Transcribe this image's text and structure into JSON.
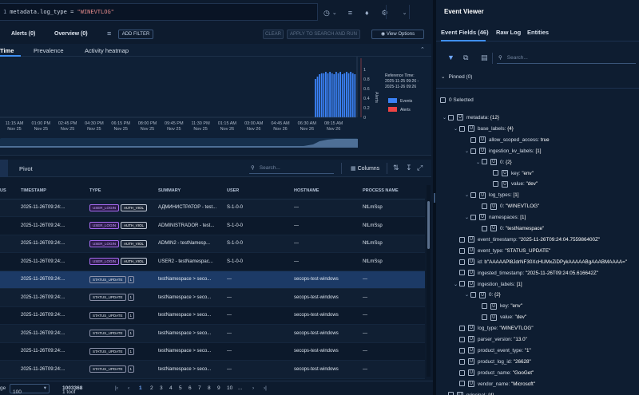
{
  "query": {
    "line": "1",
    "text_prefix": "metadata.log_type = ",
    "text_value": "\"WINEVTLOG\""
  },
  "toolbar": {
    "alerts_tab": "Alerts (0)",
    "overview_tab": "Overview (0)",
    "add_filter": "ADD FILTER",
    "clear": "CLEAR",
    "apply": "APPLY TO SEARCH AND RUN",
    "view_options": "View Options"
  },
  "chart_tabs": [
    {
      "label": "Time"
    },
    {
      "label": "Prevalence"
    },
    {
      "label": "Activity heatmap"
    }
  ],
  "chart_data": {
    "type": "bar",
    "x_tick_labels": [
      {
        "time": "11:15 AM",
        "date": "Nov 25"
      },
      {
        "time": "01:00 PM",
        "date": "Nov 25"
      },
      {
        "time": "02:45 PM",
        "date": "Nov 25"
      },
      {
        "time": "04:30 PM",
        "date": "Nov 25"
      },
      {
        "time": "06:15 PM",
        "date": "Nov 25"
      },
      {
        "time": "08:00 PM",
        "date": "Nov 25"
      },
      {
        "time": "09:45 PM",
        "date": "Nov 25"
      },
      {
        "time": "11:30 PM",
        "date": "Nov 25"
      },
      {
        "time": "01:15 AM",
        "date": "Nov 26"
      },
      {
        "time": "03:00 AM",
        "date": "Nov 26"
      },
      {
        "time": "04:45 AM",
        "date": "Nov 26"
      },
      {
        "time": "06:30 AM",
        "date": "Nov 26"
      },
      {
        "time": "08:15 AM",
        "date": "Nov 26"
      }
    ],
    "y_ticks": [
      "1",
      "0.8",
      "0.6",
      "0.4",
      "0.2",
      "0"
    ],
    "y_label": "Alerts",
    "ylim": [
      0,
      1
    ],
    "bar_values": [
      0.8,
      0.85,
      0.9,
      0.92,
      0.92,
      0.95,
      0.92,
      0.95,
      0.92,
      0.9,
      0.95,
      0.92,
      0.95,
      0.9,
      0.92,
      0.95,
      0.92,
      0.95,
      0.92,
      0.9
    ],
    "reference_title": "Reference Time:",
    "reference_from": "2025-11-25 09:26 -",
    "reference_to": "2025-11-26 09:26",
    "legend": [
      {
        "name": "Events",
        "color": "#3b82f6"
      },
      {
        "name": "Alerts",
        "color": "#ef4444"
      }
    ]
  },
  "events_bar": {
    "pivot": "Pivot",
    "search_placeholder": "Search...",
    "columns": "Columns"
  },
  "table": {
    "headers": [
      "US",
      "TIMESTAMP",
      "TYPE",
      "SUMMARY",
      "USER",
      "HOSTNAME",
      "PROCESS NAME"
    ],
    "rows": [
      {
        "ts": "2025-11-26T09:24:...",
        "t1": "USER_LOGIN",
        "t2": "AUTH_VIOL",
        "summary": "АДМИНИСТРАТОР - test...",
        "user": "S-1-0-0",
        "host": "—",
        "proc": "NtLmSsp"
      },
      {
        "ts": "2025-11-26T09:24:...",
        "t1": "USER_LOGIN",
        "t2": "AUTH_VIOL",
        "summary": "ADMINISTRADOR - test...",
        "user": "S-1-0-0",
        "host": "—",
        "proc": "NtLmSsp"
      },
      {
        "ts": "2025-11-26T09:24:...",
        "t1": "USER_LOGIN",
        "t2": "AUTH_VIOL",
        "summary": "ADMIN2 - testNamesp...",
        "user": "S-1-0-0",
        "host": "—",
        "proc": "NtLmSsp"
      },
      {
        "ts": "2025-11-26T09:24:...",
        "t1": "USER_LOGIN",
        "t2": "AUTH_VIOL",
        "summary": "USER2 - testNamespac...",
        "user": "S-1-0-0",
        "host": "—",
        "proc": "NtLmSsp"
      },
      {
        "ts": "2025-11-26T09:24:...",
        "t1": "STATUS_UPDATE",
        "t2": "1",
        "summary": "testNamespace > seco...",
        "user": "—",
        "host": "secops-test-windows",
        "proc": "—"
      },
      {
        "ts": "2025-11-26T09:24:...",
        "t1": "STATUS_UPDATE",
        "t2": "1",
        "summary": "testNamespace > seco...",
        "user": "—",
        "host": "secops-test-windows",
        "proc": "—"
      },
      {
        "ts": "2025-11-26T09:24:...",
        "t1": "STATUS_UPDATE",
        "t2": "1",
        "summary": "testNamespace > seco...",
        "user": "—",
        "host": "secops-test-windows",
        "proc": "—"
      },
      {
        "ts": "2025-11-26T09:24:...",
        "t1": "STATUS_UPDATE",
        "t2": "1",
        "summary": "testNamespace > seco...",
        "user": "—",
        "host": "secops-test-windows",
        "proc": "—"
      },
      {
        "ts": "2025-11-26T09:24:...",
        "t1": "STATUS_UPDATE",
        "t2": "1",
        "summary": "testNamespace > seco...",
        "user": "—",
        "host": "secops-test-windows",
        "proc": "—"
      },
      {
        "ts": "2025-11-26T09:24:...",
        "t1": "STATUS_UPDATE",
        "t2": "1",
        "summary": "testNamespace > seco...",
        "user": "—",
        "host": "secops-test-windows",
        "proc": "—"
      }
    ]
  },
  "pager": {
    "page_label": "ge",
    "page_size": "100",
    "range_prefix": "1 to ",
    "range_to": "100",
    "range_of": " of ",
    "total": "3368",
    "pages": [
      "1",
      "2",
      "3",
      "4",
      "5",
      "6",
      "7",
      "8",
      "9",
      "10",
      "..."
    ]
  },
  "event_viewer": {
    "title": "Event Viewer",
    "tabs": [
      "Event Fields (46)",
      "Raw Log",
      "Entities"
    ],
    "search_placeholder": "Search...",
    "pinned": "Pinned (0)",
    "selected": "0 Selected",
    "tree": [
      {
        "indent": 0,
        "chev": "v",
        "key": "metadata:",
        "val": "{12}"
      },
      {
        "indent": 1,
        "chev": "v",
        "key": "base_labels:",
        "val": "{4}"
      },
      {
        "indent": 2,
        "chev": "",
        "key": "allow_scoped_access:",
        "val": "true"
      },
      {
        "indent": 2,
        "chev": "v",
        "key": "ingestion_kv_labels:",
        "val": "[1]"
      },
      {
        "indent": 3,
        "chev": "v",
        "key": "0:",
        "val": "{2}"
      },
      {
        "indent": 4,
        "chev": "",
        "key": "key:",
        "val": "\"env\""
      },
      {
        "indent": 4,
        "chev": "",
        "key": "value:",
        "val": "\"dev\""
      },
      {
        "indent": 2,
        "chev": "v",
        "key": "log_types:",
        "val": "[1]"
      },
      {
        "indent": 3,
        "chev": "",
        "key": "0:",
        "val": "\"WINEVTLOG\""
      },
      {
        "indent": 2,
        "chev": "v",
        "key": "namespaces:",
        "val": "[1]"
      },
      {
        "indent": 3,
        "chev": "",
        "key": "0:",
        "val": "\"testNamespace\""
      },
      {
        "indent": 1,
        "chev": "",
        "key": "event_timestamp:",
        "val": "\"2025-11-26T09:24:04.755986400Z\""
      },
      {
        "indent": 1,
        "chev": "",
        "key": "event_type:",
        "val": "\"STATUS_UPDATE\""
      },
      {
        "indent": 1,
        "chev": "",
        "key": "id:",
        "val": "b\"AAAAAPl8JdrNF30XcHUMxZiDPykAAAAABgAAABMAAAA=\""
      },
      {
        "indent": 1,
        "chev": "",
        "key": "ingested_timestamp:",
        "val": "\"2025-11-26T09:24:05.616642Z\""
      },
      {
        "indent": 1,
        "chev": "v",
        "key": "ingestion_labels:",
        "val": "[1]"
      },
      {
        "indent": 2,
        "chev": "v",
        "key": "0:",
        "val": "{2}"
      },
      {
        "indent": 3,
        "chev": "",
        "key": "key:",
        "val": "\"env\""
      },
      {
        "indent": 3,
        "chev": "",
        "key": "value:",
        "val": "\"dev\""
      },
      {
        "indent": 1,
        "chev": "",
        "key": "log_type:",
        "val": "\"WINEVTLOG\""
      },
      {
        "indent": 1,
        "chev": "",
        "key": "parser_version:",
        "val": "\"13.0\""
      },
      {
        "indent": 1,
        "chev": "",
        "key": "product_event_type:",
        "val": "\"1\""
      },
      {
        "indent": 1,
        "chev": "",
        "key": "product_log_id:",
        "val": "\"26628\""
      },
      {
        "indent": 1,
        "chev": "",
        "key": "product_name:",
        "val": "\"GooGet\""
      },
      {
        "indent": 1,
        "chev": "",
        "key": "vendor_name:",
        "val": "\"Microsoft\""
      },
      {
        "indent": 0,
        "chev": "v",
        "key": "principal:",
        "val": "{4}"
      }
    ]
  }
}
